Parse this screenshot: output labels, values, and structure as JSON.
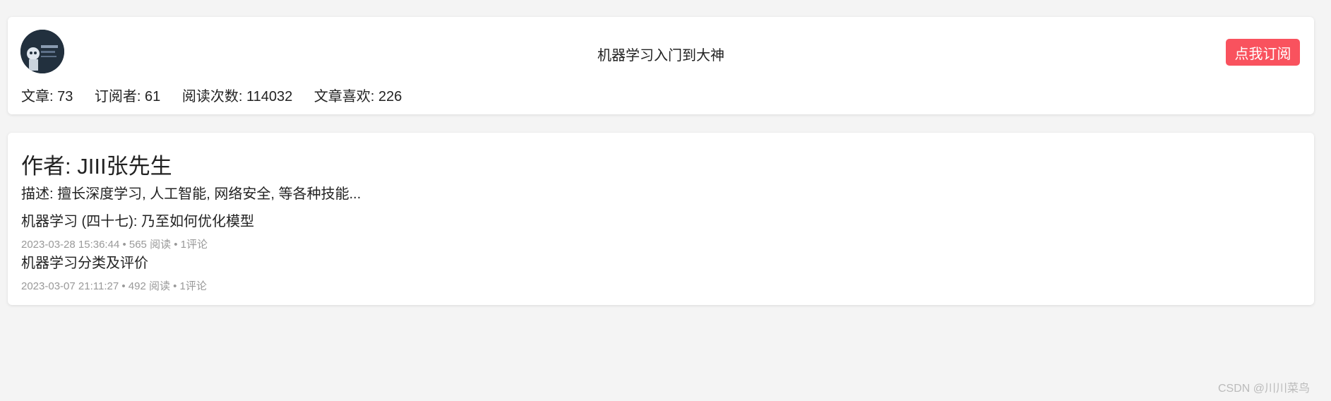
{
  "column": {
    "title": "机器学习入门到大神",
    "subscribe_label": "点我订阅",
    "avatar_alt": "机器学习",
    "stats": {
      "articles": "文章: 73",
      "subscribers": "订阅者: 61",
      "reads": "阅读次数: 114032",
      "likes": "文章喜欢: 226"
    }
  },
  "author": {
    "name": "作者: JIII张先生",
    "description": "描述: 擅长深度学习, 人工智能, 网络安全, 等各种技能..."
  },
  "articles": [
    {
      "title": "机器学习 (四十七): 乃至如何优化模型",
      "meta": "2023-03-28 15:36:44 • 565 阅读 • 1评论"
    },
    {
      "title": "机器学习分类及评价",
      "meta": "2023-03-07 21:11:27 • 492 阅读 • 1评论"
    }
  ],
  "watermark": "CSDN @川川菜鸟",
  "colors": {
    "subscribe_button": "#f9525e",
    "background": "#f4f4f4",
    "card": "#ffffff",
    "meta_text": "#999999"
  }
}
